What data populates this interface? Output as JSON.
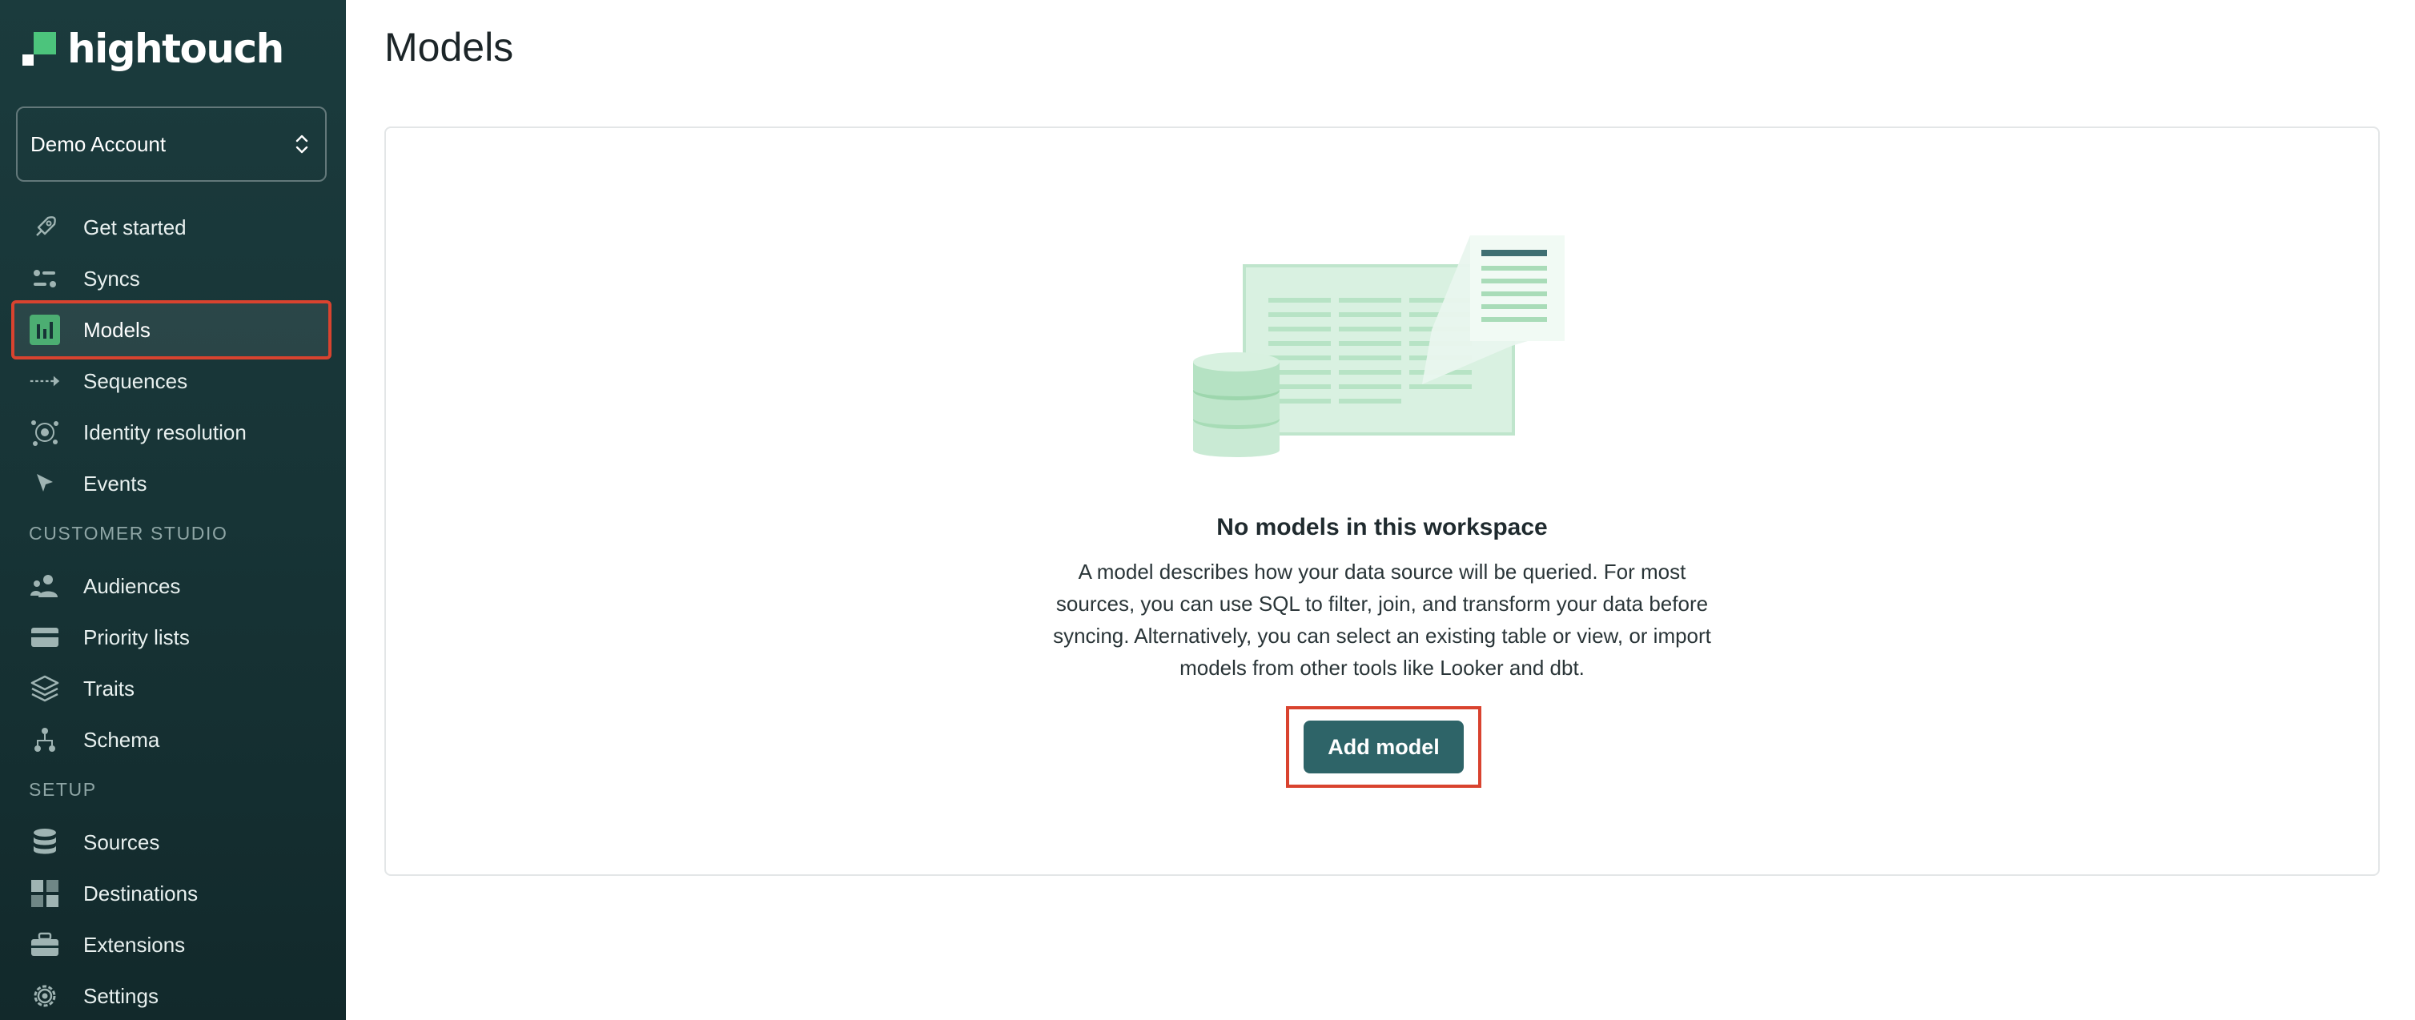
{
  "brand": {
    "name": "hightouch"
  },
  "account": {
    "selected": "Demo Account"
  },
  "nav": {
    "items": [
      {
        "label": "Get started",
        "icon": "rocket-icon"
      },
      {
        "label": "Syncs",
        "icon": "sliders-icon"
      },
      {
        "label": "Models",
        "icon": "bar-chart-icon",
        "active": true
      },
      {
        "label": "Sequences",
        "icon": "sequence-arrow-icon"
      },
      {
        "label": "Identity resolution",
        "icon": "identity-graph-icon"
      },
      {
        "label": "Events",
        "icon": "cursor-icon"
      }
    ],
    "customer_studio_heading": "CUSTOMER STUDIO",
    "customer_studio": [
      {
        "label": "Audiences",
        "icon": "people-icon"
      },
      {
        "label": "Priority lists",
        "icon": "list-card-icon"
      },
      {
        "label": "Traits",
        "icon": "layers-icon"
      },
      {
        "label": "Schema",
        "icon": "hierarchy-icon"
      }
    ],
    "setup_heading": "SETUP",
    "setup": [
      {
        "label": "Sources",
        "icon": "database-icon"
      },
      {
        "label": "Destinations",
        "icon": "grid-icon"
      },
      {
        "label": "Extensions",
        "icon": "toolbox-icon"
      },
      {
        "label": "Settings",
        "icon": "gear-icon"
      }
    ]
  },
  "main": {
    "title": "Models",
    "empty_state": {
      "title": "No models in this workspace",
      "description": "A model describes how your data source will be queried. For most sources, you can use SQL to filter, join, and transform your data before syncing. Alternatively, you can select an existing table or view, or import models from other tools like Looker and dbt.",
      "button_label": "Add model"
    }
  },
  "colors": {
    "sidebar_bg": "#1b3b3d",
    "accent_green": "#4cc47c",
    "button_bg": "#2e6468",
    "highlight_red": "#d9432f"
  }
}
